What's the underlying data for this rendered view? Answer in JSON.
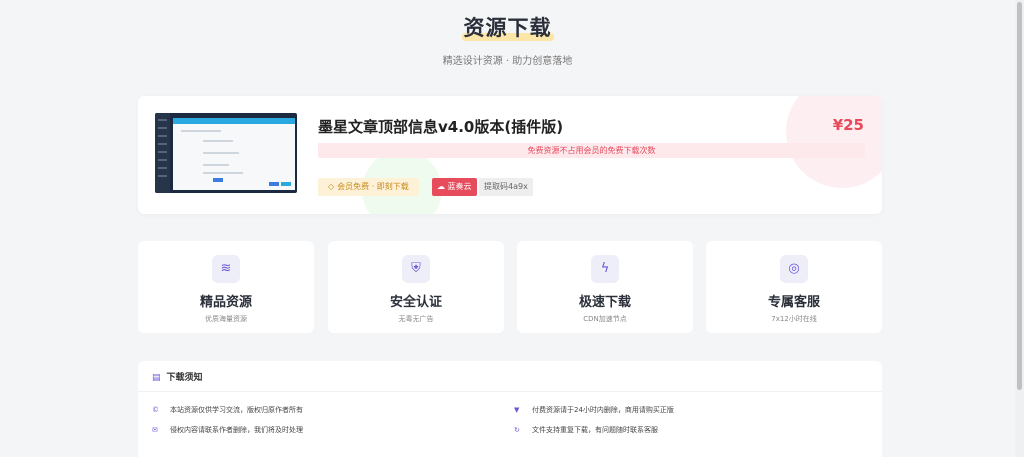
{
  "header": {
    "title": "资源下载",
    "subtitle": "精选设计资源 · 助力创意落地"
  },
  "resource": {
    "title": "墨星文章顶部信息v4.0版本(插件版)",
    "price": "¥25",
    "notice": "免费资源不占用会员的免费下载次数",
    "member_tag": "会员免费 · 即刻下载",
    "cloud_tag": "蓝奏云",
    "code_tag": "提取码4a9x"
  },
  "features": [
    {
      "icon": "database-icon",
      "title": "精品资源",
      "sub": "优质海量资源"
    },
    {
      "icon": "shield-icon",
      "title": "安全认证",
      "sub": "无毒无广告"
    },
    {
      "icon": "lightning-icon",
      "title": "极速下载",
      "sub": "CDN加速节点"
    },
    {
      "icon": "lifebuoy-icon",
      "title": "专属客服",
      "sub": "7x12小时在线"
    }
  ],
  "notes": {
    "title": "下载须知",
    "items": [
      {
        "icon": "copyright-icon",
        "text": "本站资源仅供学习交流，版权归原作者所有"
      },
      {
        "icon": "cart-icon",
        "text": "付费资源请于24小时内删除，商用请购买正版"
      },
      {
        "icon": "mail-icon",
        "text": "侵权内容请联系作者删除，我们将及时处理"
      },
      {
        "icon": "refresh-icon",
        "text": "文件支持重复下载，有问题随时联系客服"
      }
    ]
  },
  "colors": {
    "accent": "#6a57d8",
    "price": "#e64a5a",
    "highlight": "#fbe6a7"
  }
}
